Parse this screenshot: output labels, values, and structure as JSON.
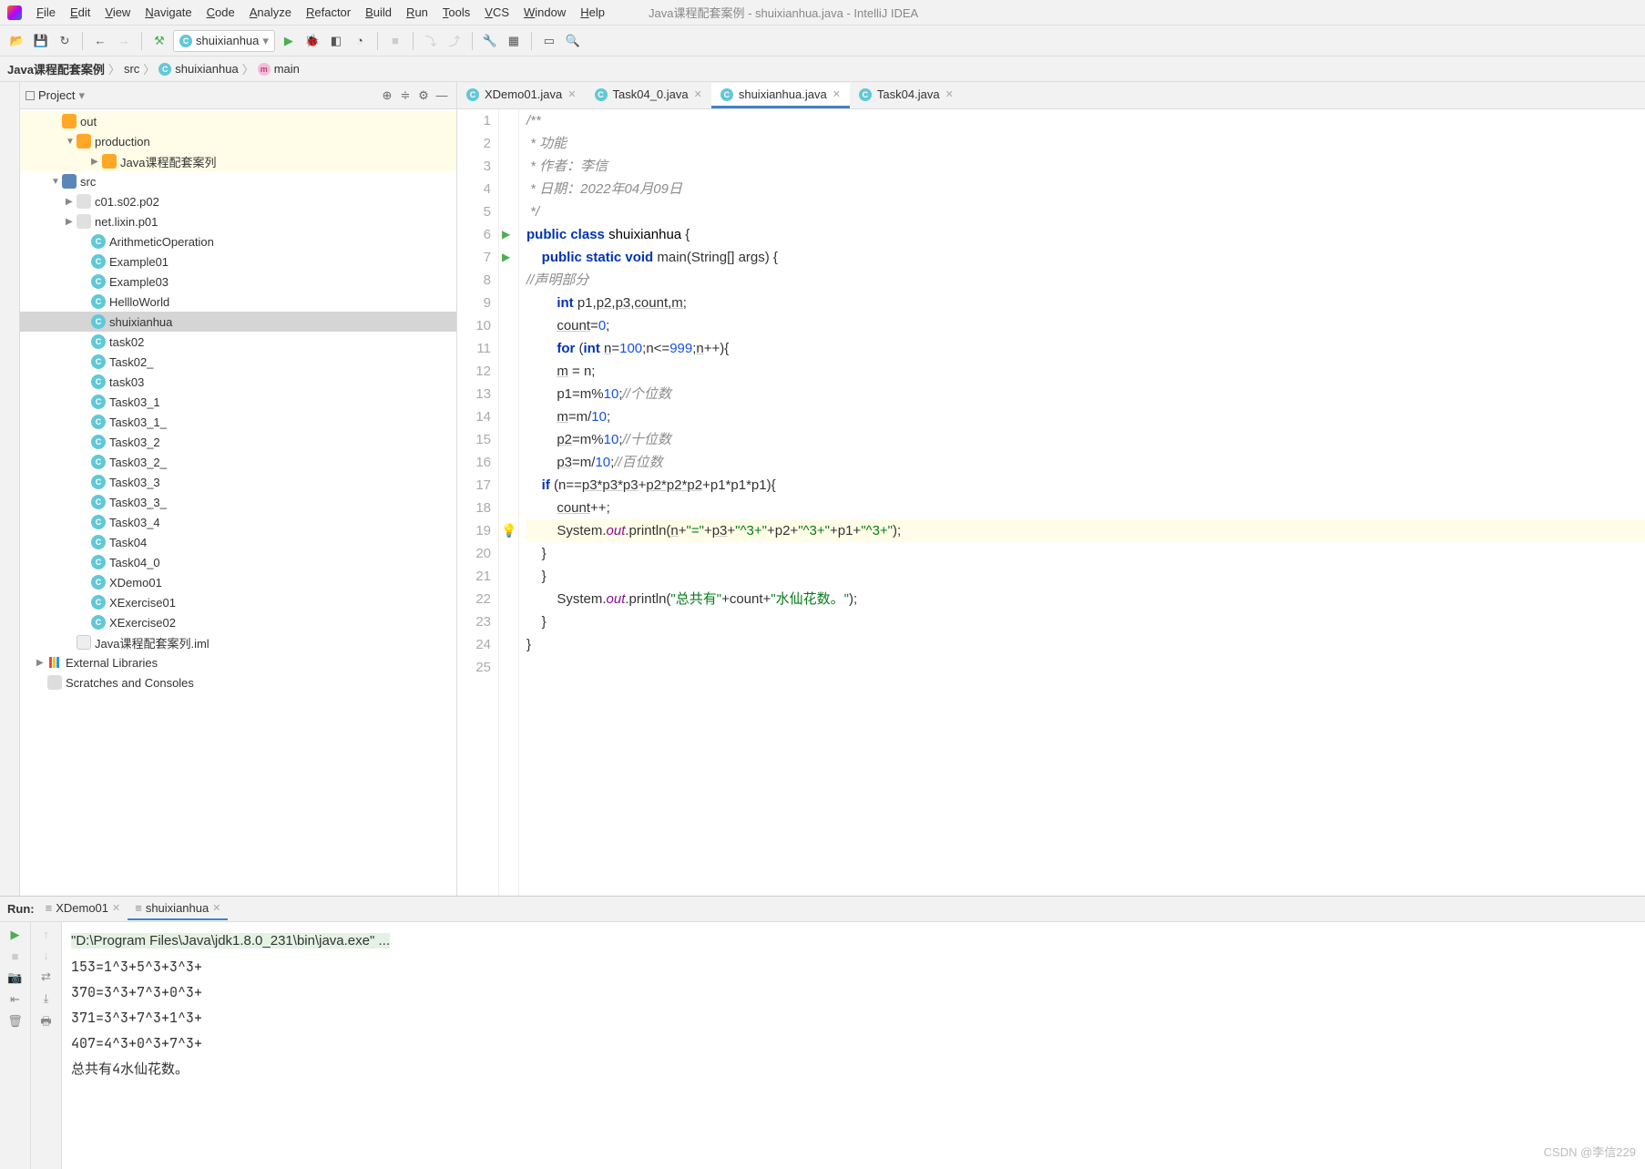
{
  "window_title": "Java课程配套案例 - shuixianhua.java - IntelliJ IDEA",
  "menu": [
    "File",
    "Edit",
    "View",
    "Navigate",
    "Code",
    "Analyze",
    "Refactor",
    "Build",
    "Run",
    "Tools",
    "VCS",
    "Window",
    "Help"
  ],
  "run_config": "shuixianhua",
  "breadcrumb": {
    "project": "Java课程配套案例",
    "src": "src",
    "class": "shuixianhua",
    "method": "main"
  },
  "project_panel": {
    "title": "Project",
    "tree": [
      {
        "indent": 34,
        "arrow": "",
        "icon": "folder",
        "label": "out",
        "hl": true
      },
      {
        "indent": 50,
        "arrow": "▼",
        "icon": "folder",
        "label": "production",
        "hl": true
      },
      {
        "indent": 78,
        "arrow": "▶",
        "icon": "folder",
        "label": "Java课程配套案列",
        "hl": true
      },
      {
        "indent": 34,
        "arrow": "▼",
        "icon": "src",
        "label": "src"
      },
      {
        "indent": 50,
        "arrow": "▶",
        "icon": "folder-g",
        "label": "c01.s02.p02"
      },
      {
        "indent": 50,
        "arrow": "▶",
        "icon": "folder-g",
        "label": "net.lixin.p01"
      },
      {
        "indent": 66,
        "arrow": "",
        "icon": "c",
        "label": "ArithmeticOperation"
      },
      {
        "indent": 66,
        "arrow": "",
        "icon": "c",
        "label": "Example01"
      },
      {
        "indent": 66,
        "arrow": "",
        "icon": "c",
        "label": "Example03"
      },
      {
        "indent": 66,
        "arrow": "",
        "icon": "c",
        "label": "HellloWorld"
      },
      {
        "indent": 66,
        "arrow": "",
        "icon": "c",
        "label": "shuixianhua",
        "sel": true
      },
      {
        "indent": 66,
        "arrow": "",
        "icon": "c",
        "label": "task02"
      },
      {
        "indent": 66,
        "arrow": "",
        "icon": "c",
        "label": "Task02_"
      },
      {
        "indent": 66,
        "arrow": "",
        "icon": "c",
        "label": "task03"
      },
      {
        "indent": 66,
        "arrow": "",
        "icon": "c",
        "label": "Task03_1"
      },
      {
        "indent": 66,
        "arrow": "",
        "icon": "c",
        "label": "Task03_1_"
      },
      {
        "indent": 66,
        "arrow": "",
        "icon": "c",
        "label": "Task03_2"
      },
      {
        "indent": 66,
        "arrow": "",
        "icon": "c",
        "label": "Task03_2_"
      },
      {
        "indent": 66,
        "arrow": "",
        "icon": "c",
        "label": "Task03_3"
      },
      {
        "indent": 66,
        "arrow": "",
        "icon": "c",
        "label": "Task03_3_"
      },
      {
        "indent": 66,
        "arrow": "",
        "icon": "c",
        "label": "Task03_4"
      },
      {
        "indent": 66,
        "arrow": "",
        "icon": "c",
        "label": "Task04"
      },
      {
        "indent": 66,
        "arrow": "",
        "icon": "c",
        "label": "Task04_0"
      },
      {
        "indent": 66,
        "arrow": "",
        "icon": "c",
        "label": "XDemo01"
      },
      {
        "indent": 66,
        "arrow": "",
        "icon": "c",
        "label": "XExercise01"
      },
      {
        "indent": 66,
        "arrow": "",
        "icon": "c",
        "label": "XExercise02"
      },
      {
        "indent": 50,
        "arrow": "",
        "icon": "file",
        "label": "Java课程配套案列.iml"
      },
      {
        "indent": 18,
        "arrow": "▶",
        "icon": "lib",
        "label": "External Libraries"
      },
      {
        "indent": 18,
        "arrow": "",
        "icon": "scratch",
        "label": "Scratches and Consoles"
      }
    ]
  },
  "tabs": [
    {
      "label": "XDemo01.java",
      "active": false
    },
    {
      "label": "Task04_0.java",
      "active": false
    },
    {
      "label": "shuixianhua.java",
      "active": true
    },
    {
      "label": "Task04.java",
      "active": false
    }
  ],
  "code_lines": [
    {
      "n": 1,
      "html": "<span class='cmt'>/**</span>"
    },
    {
      "n": 2,
      "html": "<span class='cmt'> * 功能</span>"
    },
    {
      "n": 3,
      "html": "<span class='cmt'> * 作者：李信</span>"
    },
    {
      "n": 4,
      "html": "<span class='cmt'> * 日期：2022年04月09日</span>"
    },
    {
      "n": 5,
      "html": "<span class='cmt'> */</span>"
    },
    {
      "n": 6,
      "run": true,
      "html": "<span class='kw'>public</span> <span class='kw'>class</span> <span class='cls'>shuixianhua</span> {"
    },
    {
      "n": 7,
      "run": true,
      "html": "    <span class='kw'>public</span> <span class='kw'>static</span> <span class='kw'>void</span> main(String[] args) {"
    },
    {
      "n": 8,
      "html": "<span class='cmt'>//声明部分</span>"
    },
    {
      "n": 9,
      "html": "        <span class='kw'>int</span> p1,<span class='uline'>p2</span>,<span class='uline'>p3</span>,<span class='uline'>count</span>,<span class='uline'>m</span>;"
    },
    {
      "n": 10,
      "html": "        <span class='uline'>count</span>=<span class='num'>0</span>;"
    },
    {
      "n": 11,
      "html": "        <span class='kw'>for</span> (<span class='kw'>int</span> <span class='uline'>n</span>=<span class='num'>100</span>;n&lt;=<span class='num'>999</span>;<span class='uline'>n</span>++){"
    },
    {
      "n": 12,
      "html": "        <span class='uline'>m</span> = n;"
    },
    {
      "n": 13,
      "html": "        p1=m%<span class='num'>10</span>;<span class='cmt'>//个位数</span>"
    },
    {
      "n": 14,
      "html": "        <span class='uline'>m</span>=m/<span class='num'>10</span>;"
    },
    {
      "n": 15,
      "html": "        <span class='uline'>p2</span>=m%<span class='num'>10</span>;<span class='cmt'>//十位数</span>"
    },
    {
      "n": 16,
      "html": "        <span class='uline'>p3</span>=m/<span class='num'>10</span>;<span class='cmt'>//百位数</span>"
    },
    {
      "n": 17,
      "html": "    <span class='kw'>if</span> (n==<span class='uline'>p3*p3*p3</span>+<span class='uline'>p2*p2*p2</span>+p1*p1*p1){"
    },
    {
      "n": 18,
      "html": "        <span class='uline'>count</span>++;"
    },
    {
      "n": 19,
      "bulb": true,
      "hl": true,
      "html": "        System.<span class='fld'>out</span>.println(<span class='uline'>n</span>+<span class='str'>\"=\"</span>+<span class='uline'>p3</span>+<span class='str'>\"^3+\"</span>+p2+<span class='str'>\"^3+\"</span>+p1+<span class='str'>\"^3+\"</span>);"
    },
    {
      "n": 20,
      "html": "    }"
    },
    {
      "n": 21,
      "html": "    }"
    },
    {
      "n": 22,
      "html": "        System.<span class='fld'>out</span>.println(<span class='str'>\"总共有\"</span>+count+<span class='str'>\"水仙花数。\"</span>);"
    },
    {
      "n": 23,
      "html": "    }"
    },
    {
      "n": 24,
      "html": "}"
    },
    {
      "n": 25,
      "html": ""
    }
  ],
  "run_panel": {
    "label": "Run:",
    "tabs": [
      {
        "label": "XDemo01",
        "active": false
      },
      {
        "label": "shuixianhua",
        "active": true
      }
    ],
    "cmd": "\"D:\\Program Files\\Java\\jdk1.8.0_231\\bin\\java.exe\" ...",
    "output": [
      "153=1^3+5^3+3^3+",
      "370=3^3+7^3+0^3+",
      "371=3^3+7^3+1^3+",
      "407=4^3+0^3+7^3+",
      "总共有4水仙花数。"
    ]
  },
  "watermark": "CSDN @李信229"
}
